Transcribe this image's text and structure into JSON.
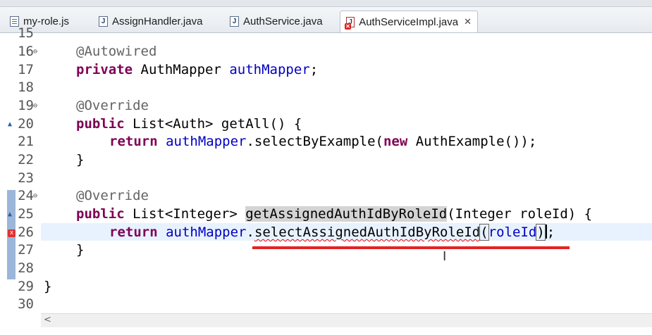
{
  "tabs": [
    {
      "label": "my-role.js",
      "icon": "js-file-icon"
    },
    {
      "label": "AssignHandler.java",
      "icon": "java-file-icon"
    },
    {
      "label": "AuthService.java",
      "icon": "java-file-icon"
    },
    {
      "label": "AuthServiceImpl.java",
      "icon": "java-error-file-icon",
      "active": true,
      "close": "✕"
    }
  ],
  "editor": {
    "lines": [
      {
        "n": "15"
      },
      {
        "n": "16",
        "fold": "⊖"
      },
      {
        "n": "17"
      },
      {
        "n": "18"
      },
      {
        "n": "19",
        "fold": "⊖"
      },
      {
        "n": "20",
        "override": "▲"
      },
      {
        "n": "21"
      },
      {
        "n": "22"
      },
      {
        "n": "23"
      },
      {
        "n": "24",
        "fold": "⊖"
      },
      {
        "n": "25",
        "override": "▲"
      },
      {
        "n": "26",
        "error": "x"
      },
      {
        "n": "27"
      },
      {
        "n": "28"
      },
      {
        "n": "29"
      },
      {
        "n": "30"
      }
    ],
    "code": {
      "l16_ann": "@Autowired",
      "l17_kw": "private",
      "l17_type": " AuthMapper ",
      "l17_field": "authMapper",
      "l17_end": ";",
      "l19_ann": "@Override",
      "l20_kw": "public",
      "l20_rest": " List<Auth> getAll() {",
      "l21_kw": "return",
      "l21_field": "authMapper",
      "l21_mid": ".selectByExample(",
      "l21_kw2": "new",
      "l21_end": " AuthExample());",
      "l22": "}",
      "l24_ann": "@Override",
      "l25_kw": "public",
      "l25_type": " List<Integer> ",
      "l25_method": "getAssignedAuthIdByRoleId",
      "l25_end": "(Integer roleId) {",
      "l26_kw": "return",
      "l26_field": "authMapper",
      "l26_dot": ".",
      "l26_method": "selectAssignedAuthIdByRoleId",
      "l26_open": "(",
      "l26_arg": "roleId",
      "l26_close": ")",
      "l26_end": ";",
      "l27": "}",
      "l29": "}"
    }
  },
  "scroll": {
    "left_arrow": "<"
  },
  "colors": {
    "keyword": "#7f0055",
    "annotation": "#646464",
    "field": "#0000c0",
    "error_underline": "#e00000",
    "current_line": "#e8f2fe",
    "red_mark": "#e52222"
  }
}
